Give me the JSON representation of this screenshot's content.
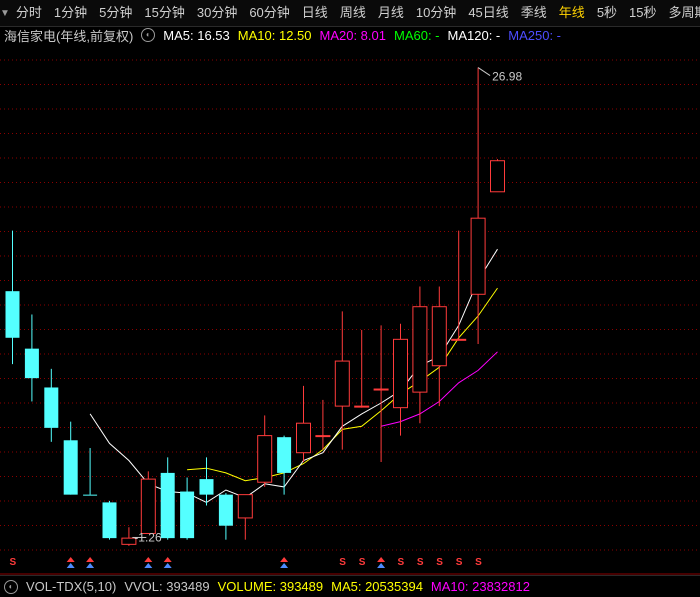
{
  "tabs": [
    {
      "label": "分时",
      "active": false
    },
    {
      "label": "1分钟",
      "active": false
    },
    {
      "label": "5分钟",
      "active": false
    },
    {
      "label": "15分钟",
      "active": false
    },
    {
      "label": "30分钟",
      "active": false
    },
    {
      "label": "60分钟",
      "active": false
    },
    {
      "label": "日线",
      "active": false
    },
    {
      "label": "周线",
      "active": false
    },
    {
      "label": "月线",
      "active": false
    },
    {
      "label": "10分钟",
      "active": false
    },
    {
      "label": "45日线",
      "active": false
    },
    {
      "label": "季线",
      "active": false
    },
    {
      "label": "年线",
      "active": true
    },
    {
      "label": "5秒",
      "active": false
    },
    {
      "label": "15秒",
      "active": false
    },
    {
      "label": "多周期",
      "active": false
    }
  ],
  "infobar": {
    "title": "海信家电(年线,前复权)",
    "ma5": "MA5: 16.53",
    "ma10": "MA10: 12.50",
    "ma20": "MA20: 8.01",
    "ma60": "MA60: -",
    "ma120": "MA120: -",
    "ma250": "MA250: -"
  },
  "volbar": {
    "indicator": "VOL-TDX(5,10)",
    "vvol": "VVOL: 393489",
    "volume": "VOLUME: 393489",
    "ma5": "MA5: 20535394",
    "ma10": "MA10: 23832812"
  },
  "colors": {
    "up": "#ff3b3b",
    "down": "#54ffff",
    "ma5": "#ffffff",
    "ma10": "#ffff00",
    "ma20": "#ff00ff",
    "ma60": "#00ff00",
    "ma120": "#ffffff",
    "ma250": "#4d4dff",
    "active_tab": "#ffd200",
    "grid": "#8b0000",
    "bg": "#000000"
  },
  "chart_data": {
    "type": "candlestick",
    "price_range": [
      -1.26,
      26.98
    ],
    "max_label": "26.98",
    "min_label": "-1.26",
    "candles": [
      {
        "o": 12.6,
        "c": 9.6,
        "h": 16.5,
        "l": 7.9
      },
      {
        "o": 8.9,
        "c": 7.0,
        "h": 11.1,
        "l": 5.5
      },
      {
        "o": 6.4,
        "c": 3.8,
        "h": 7.6,
        "l": 2.9
      },
      {
        "o": 3.0,
        "c": -0.5,
        "h": 4.2,
        "l": -0.5
      },
      {
        "o": -0.5,
        "c": -0.5,
        "h": 2.5,
        "l": -0.5
      },
      {
        "o": -1.0,
        "c": -3.3,
        "h": -0.9,
        "l": -3.4
      },
      {
        "o": -3.7,
        "c": -3.3,
        "h": -2.6,
        "l": -3.8
      },
      {
        "o": -3.0,
        "c": 0.5,
        "h": 1.0,
        "l": -3.0
      },
      {
        "o": 0.9,
        "c": -3.3,
        "h": 1.9,
        "l": -3.4
      },
      {
        "o": -0.3,
        "c": -3.3,
        "h": 0.6,
        "l": -3.4
      },
      {
        "o": 0.5,
        "c": -0.5,
        "h": 1.9,
        "l": -1.2
      },
      {
        "o": -0.5,
        "c": -2.5,
        "h": -0.4,
        "l": -3.4
      },
      {
        "o": -2.0,
        "c": -0.5,
        "h": -0.5,
        "l": -3.4
      },
      {
        "o": 0.3,
        "c": 3.3,
        "h": 4.6,
        "l": 0.0
      },
      {
        "o": 3.2,
        "c": 0.9,
        "h": 3.3,
        "l": -0.5
      },
      {
        "o": 2.2,
        "c": 4.1,
        "h": 6.5,
        "l": 1.6
      },
      {
        "o": 3.3,
        "c": 3.3,
        "h": 5.6,
        "l": 2.4
      },
      {
        "o": 5.2,
        "c": 8.1,
        "h": 11.3,
        "l": 2.4
      },
      {
        "o": 5.2,
        "c": 5.2,
        "h": 10.1,
        "l": 5.1
      },
      {
        "o": 6.3,
        "c": 6.3,
        "h": 10.4,
        "l": 1.6
      },
      {
        "o": 5.1,
        "c": 9.5,
        "h": 10.5,
        "l": 3.3
      },
      {
        "o": 6.1,
        "c": 11.6,
        "h": 12.9,
        "l": 4.1
      },
      {
        "o": 7.8,
        "c": 11.6,
        "h": 12.9,
        "l": 5.2
      },
      {
        "o": 9.5,
        "c": 9.5,
        "h": 16.5,
        "l": 9.5
      },
      {
        "o": 12.4,
        "c": 17.3,
        "h": 27.0,
        "l": 9.2
      },
      {
        "o": 19.0,
        "c": 21.0,
        "h": 21.1,
        "l": 19.0
      }
    ],
    "ma5": [
      null,
      null,
      null,
      null,
      4.7,
      2.8,
      1.7,
      0.2,
      -0.3,
      -0.4,
      -1.0,
      -0.2,
      -0.7,
      0.2,
      0.0,
      1.7,
      2.2,
      3.9,
      4.7,
      5.4,
      6.2,
      7.8,
      8.4,
      10.4,
      13.3,
      15.3
    ],
    "ma10": [
      null,
      null,
      null,
      null,
      null,
      null,
      null,
      null,
      null,
      1.1,
      1.2,
      0.9,
      0.4,
      0.6,
      0.9,
      1.5,
      2.4,
      3.7,
      3.9,
      4.9,
      6.0,
      6.8,
      7.7,
      9.6,
      11.0,
      12.8
    ],
    "ma20": [
      null,
      null,
      null,
      null,
      null,
      null,
      null,
      null,
      null,
      null,
      null,
      null,
      null,
      null,
      null,
      null,
      null,
      null,
      null,
      3.9,
      4.2,
      4.7,
      5.5,
      6.7,
      7.5,
      8.7
    ],
    "vol_markers": [
      {
        "i": 0,
        "s": "S"
      },
      {
        "i": 3,
        "s": "B"
      },
      {
        "i": 4,
        "s": "B"
      },
      {
        "i": 7,
        "s": "B"
      },
      {
        "i": 8,
        "s": "B"
      },
      {
        "i": 14,
        "s": "B"
      },
      {
        "i": 17,
        "s": "S"
      },
      {
        "i": 18,
        "s": "S"
      },
      {
        "i": 19,
        "s": "B"
      },
      {
        "i": 20,
        "s": "S"
      },
      {
        "i": 21,
        "s": "S"
      },
      {
        "i": 22,
        "s": "S"
      },
      {
        "i": 23,
        "s": "S"
      },
      {
        "i": 24,
        "s": "S"
      }
    ]
  }
}
